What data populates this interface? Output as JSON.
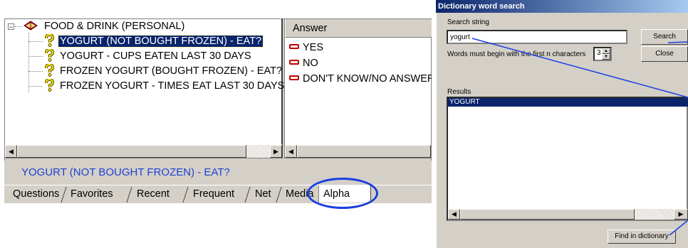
{
  "tree": {
    "root_label": "FOOD & DRINK (PERSONAL)",
    "root_expander": "−",
    "items": [
      {
        "label": "YOGURT (NOT BOUGHT FROZEN) - EAT?",
        "selected": true
      },
      {
        "label": "YOGURT - CUPS EATEN LAST 30 DAYS",
        "selected": false
      },
      {
        "label": "FROZEN YOGURT (BOUGHT FROZEN) - EAT?",
        "selected": false
      },
      {
        "label": "FROZEN YOGURT - TIMES EAT LAST 30 DAYS",
        "selected": false
      }
    ]
  },
  "answers": {
    "header": "Answer",
    "items": [
      "YES",
      "NO",
      "DON'T KNOW/NO ANSWER"
    ]
  },
  "status_text": "YOGURT (NOT BOUGHT FROZEN) - EAT?",
  "tabs": [
    "Questions",
    "Favorites",
    "Recent",
    "Frequent",
    "Net",
    "Media",
    "Alpha"
  ],
  "active_tab": "Alpha",
  "dialog": {
    "title": "Dictionary word search",
    "search_label": "Search string",
    "search_value": "yogurt",
    "search_button": "Search",
    "close_button": "Close",
    "chars_label": "Words must begin with the first n characters",
    "chars_value": "3",
    "results_label": "Results",
    "results": [
      "YOGURT"
    ],
    "find_button": "Find in dictionary"
  },
  "colors": {
    "annotation": "#1a3fe0",
    "selection": "#0a246a",
    "status_text": "#1f3fd0",
    "answer_marker": "#c00000"
  }
}
